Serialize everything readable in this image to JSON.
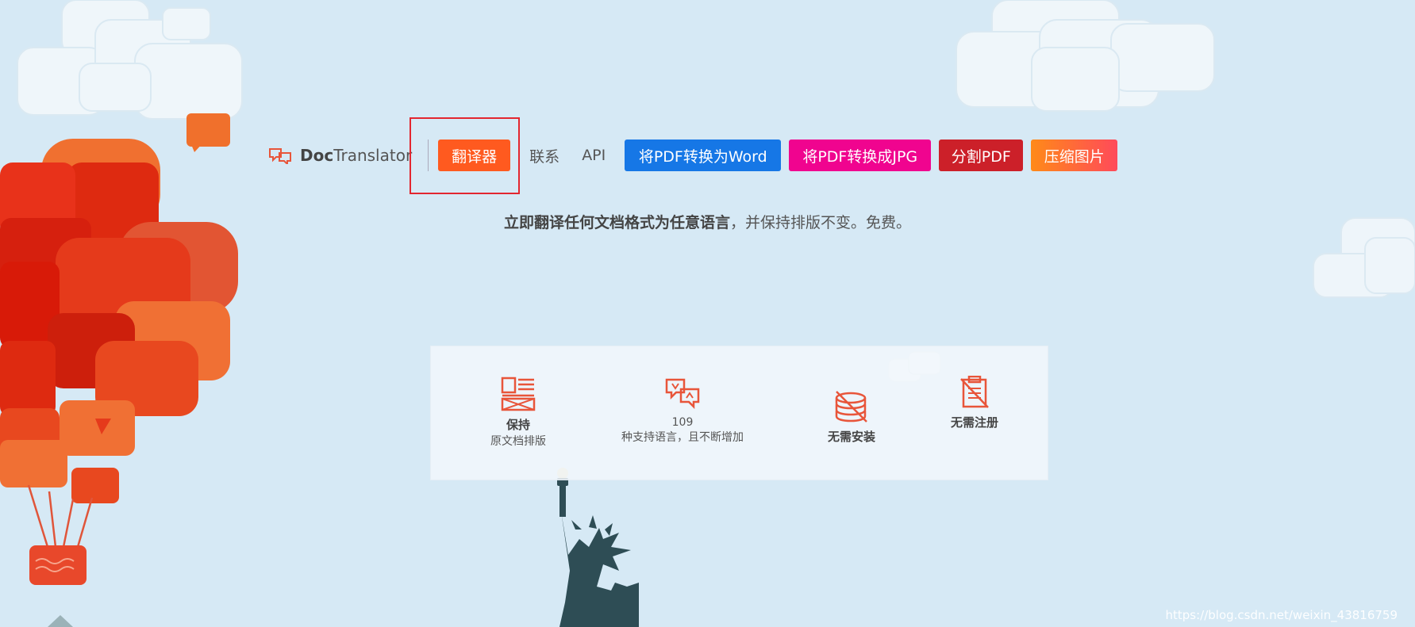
{
  "brand": {
    "name_bold": "Doc",
    "name_rest": "Translator"
  },
  "nav": {
    "translator": "翻译器",
    "contact": "联系",
    "api": "API",
    "pdf_to_word": "将PDF转换为Word",
    "pdf_to_jpg": "将PDF转换成JPG",
    "split_pdf": "分割PDF",
    "compress_image": "压缩图片"
  },
  "tagline": {
    "bold": "立即翻译任何文档格式为任意语言",
    "rest": "，并保持排版不变。免费。"
  },
  "features": [
    {
      "title": "保持",
      "subtitle": "原文档排版",
      "icon": "layout-icon"
    },
    {
      "title": "109",
      "subtitle": "种支持语言，且不断增加",
      "icon": "translate-icon"
    },
    {
      "title": "无需安装",
      "subtitle": "",
      "icon": "no-install-icon"
    },
    {
      "title": "无需注册",
      "subtitle": "",
      "icon": "no-register-icon"
    }
  ],
  "watermark": "https://blog.csdn.net/weixin_43816759",
  "colors": {
    "orange": "#ff5a1f",
    "blue": "#1677e6",
    "pink": "#f0048f",
    "red": "#cc2029",
    "background": "#d6e9f5"
  }
}
